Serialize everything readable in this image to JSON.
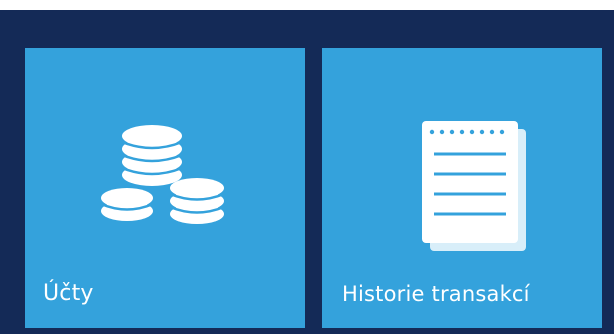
{
  "tiles": [
    {
      "id": "accounts",
      "label": "Účty",
      "icon": "coins-icon"
    },
    {
      "id": "history",
      "label": "Historie transakcí",
      "icon": "notepad-icon"
    }
  ],
  "colors": {
    "frame": "#142a57",
    "tile": "#34a2dc",
    "foreground": "#ffffff"
  }
}
